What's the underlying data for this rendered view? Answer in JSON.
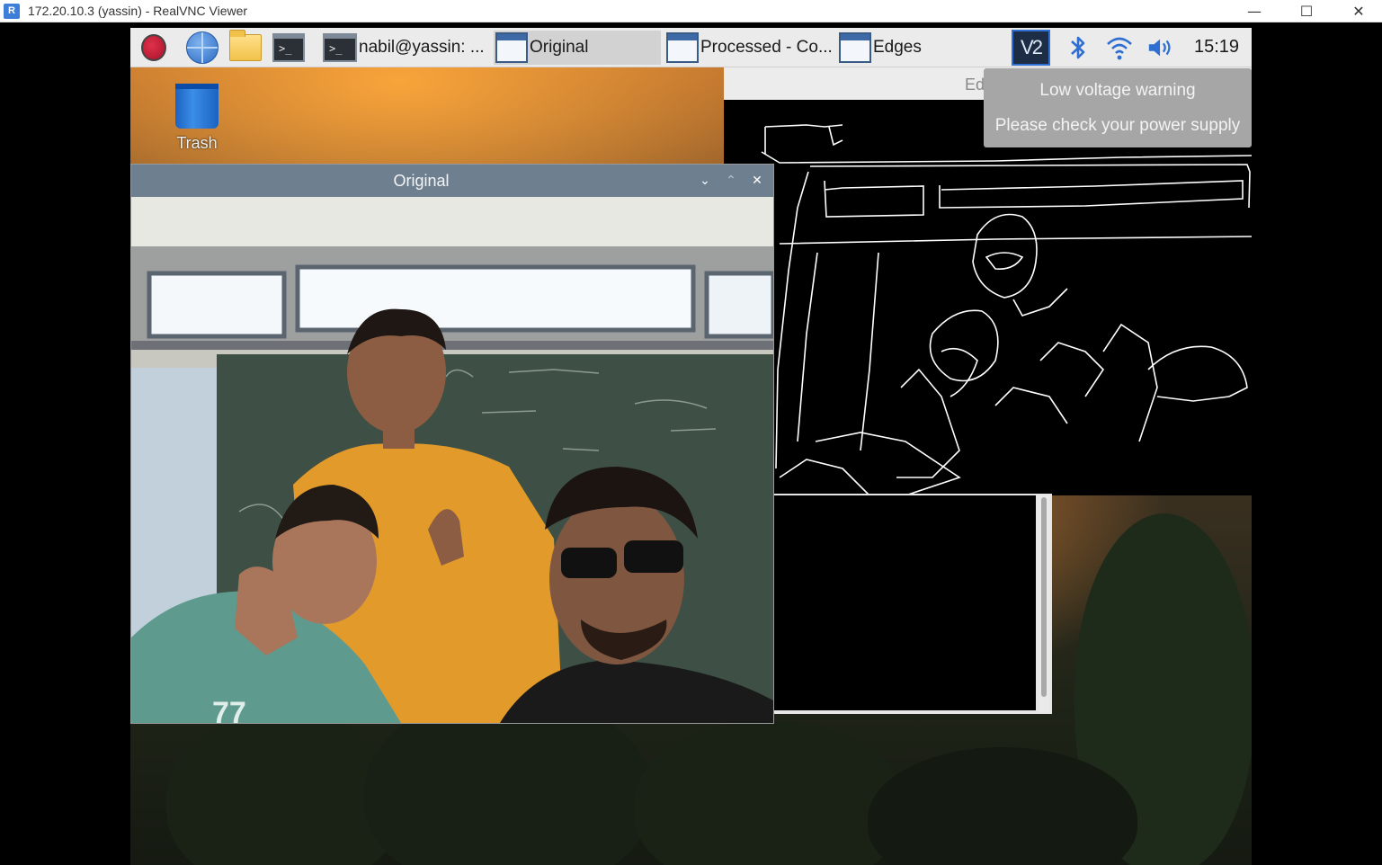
{
  "viewer": {
    "title": "172.20.10.3 (yassin) - RealVNC Viewer",
    "logo_text": "R",
    "minimize": "—",
    "maximize": "☐",
    "close": "✕"
  },
  "panel": {
    "taskbar": [
      {
        "label": "nabil@yassin: ...",
        "icon": "terminal-icon"
      },
      {
        "label": "Original",
        "icon": "window-icon",
        "active": true
      },
      {
        "label": "Processed - Co...",
        "icon": "window-icon"
      },
      {
        "label": "Edges",
        "icon": "window-icon"
      }
    ],
    "launchers": [
      "raspberry-menu-icon",
      "browser-globe-icon",
      "file-manager-folder-icon",
      "terminal-icon"
    ],
    "tray": {
      "vnc_label": "V2",
      "bluetooth": "bluetooth-icon",
      "wifi": "wifi-icon",
      "volume": "volume-icon",
      "clock": "15:19"
    }
  },
  "desktop": {
    "trash_label": "Trash"
  },
  "windows": {
    "original": {
      "title": "Original",
      "btn_min": "⌄",
      "btn_max": "⌃",
      "btn_close": "✕"
    },
    "edges": {
      "title": "Ed"
    },
    "processed": {
      "title": ""
    }
  },
  "notification": {
    "title": "Low voltage warning",
    "body": "Please check your power supply"
  },
  "colors": {
    "panel_bg": "#ebebeb",
    "titlebar_active": "#6e7f8f",
    "notification_bg": "#a6a6a6",
    "vnc_tray_border": "#2f6fd1"
  }
}
